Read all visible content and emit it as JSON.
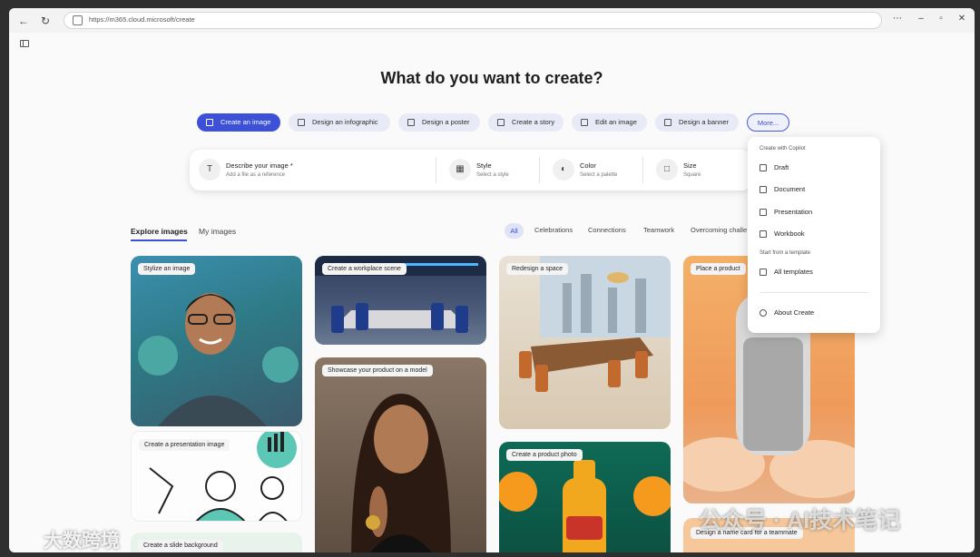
{
  "browser": {
    "url": "https://m365.cloud.microsoft/create"
  },
  "page": {
    "title": "What do you want to create?"
  },
  "chips": [
    {
      "label": "Create an image",
      "active": true
    },
    {
      "label": "Design an infographic"
    },
    {
      "label": "Design a poster"
    },
    {
      "label": "Create a story"
    },
    {
      "label": "Edit an image"
    },
    {
      "label": "Design a banner"
    },
    {
      "label": "More..."
    }
  ],
  "prompt": {
    "describe": {
      "label": "Describe your image *",
      "sub": "Add a file as a reference"
    },
    "style": {
      "label": "Style",
      "sub": "Select a style"
    },
    "color": {
      "label": "Color",
      "sub": "Select a palette"
    },
    "size": {
      "label": "Size",
      "sub": "Square"
    }
  },
  "tabs": [
    "Explore images",
    "My images"
  ],
  "filters": [
    "All",
    "Celebrations",
    "Connections",
    "Teamwork",
    "Overcoming challe"
  ],
  "cards": [
    "Stylize an image",
    "Create a presentation image",
    "Create a slide background",
    "Create a workplace scene",
    "Showcase your product on a model",
    "Redesign a space",
    "Create a product photo",
    "Place a product",
    "Design a name card for a teammate"
  ],
  "menu": {
    "section1": "Create with Copilot",
    "items1": [
      "Draft",
      "Document",
      "Presentation",
      "Workbook"
    ],
    "section2": "Start from a template",
    "items2": [
      "All templates"
    ],
    "items3": [
      "About Create"
    ]
  },
  "watermarks": {
    "left": "大数跨境",
    "right": "公众号 · AI技术笔记"
  },
  "colors": {
    "accent": "#3d50d8",
    "chip_bg": "#e8ebf7"
  }
}
